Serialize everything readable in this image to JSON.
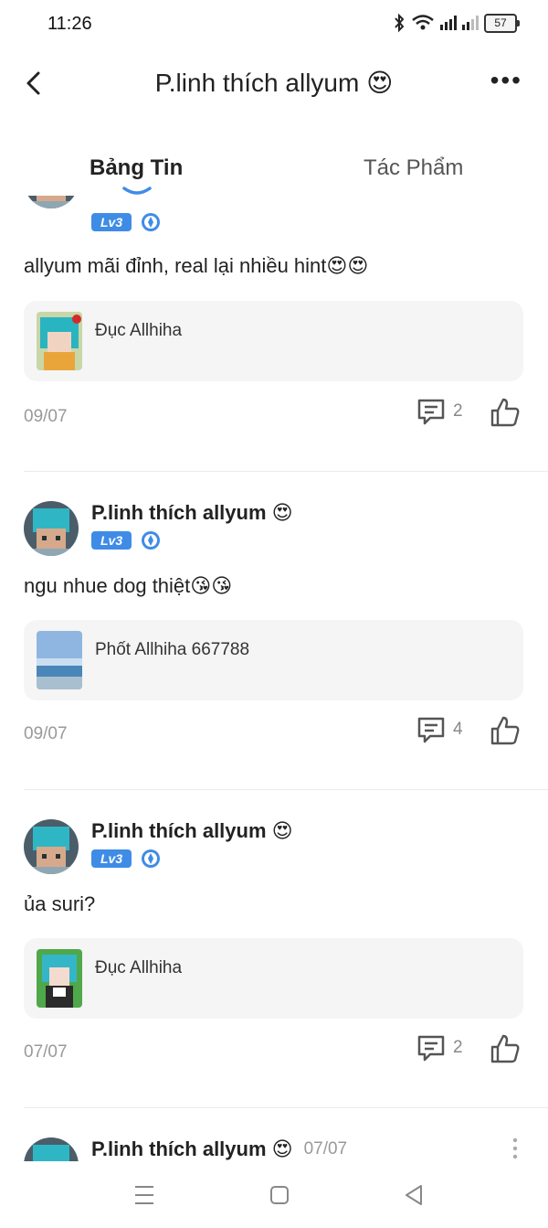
{
  "status_bar": {
    "time": "11:26",
    "battery": "57"
  },
  "header": {
    "title": "P.linh thích allyum 😍"
  },
  "tabs": [
    {
      "label": "Bảng Tin"
    },
    {
      "label": "Tác Phẩm"
    }
  ],
  "posts": [
    {
      "level": "Lv3",
      "content": "allyum mãi đỉnh, real lại nhiều hint😍😍",
      "card_title": "Đục Allhiha",
      "date": "09/07",
      "comments": "2"
    },
    {
      "author": "P.linh thích allyum 😍",
      "level": "Lv3",
      "content": "ngu nhue dog thiệt😘😘",
      "card_title": "Phốt Allhiha 667788",
      "date": "09/07",
      "comments": "4"
    },
    {
      "author": "P.linh thích allyum 😍",
      "level": "Lv3",
      "content": "ủa suri?",
      "card_title": "Đục Allhiha",
      "date": "07/07",
      "comments": "2"
    },
    {
      "author": "P.linh thích allyum 😍",
      "date": "07/07"
    }
  ],
  "colors": {
    "accent": "#3f8ce6",
    "muted": "#999999",
    "card_bg": "#f5f5f5"
  }
}
